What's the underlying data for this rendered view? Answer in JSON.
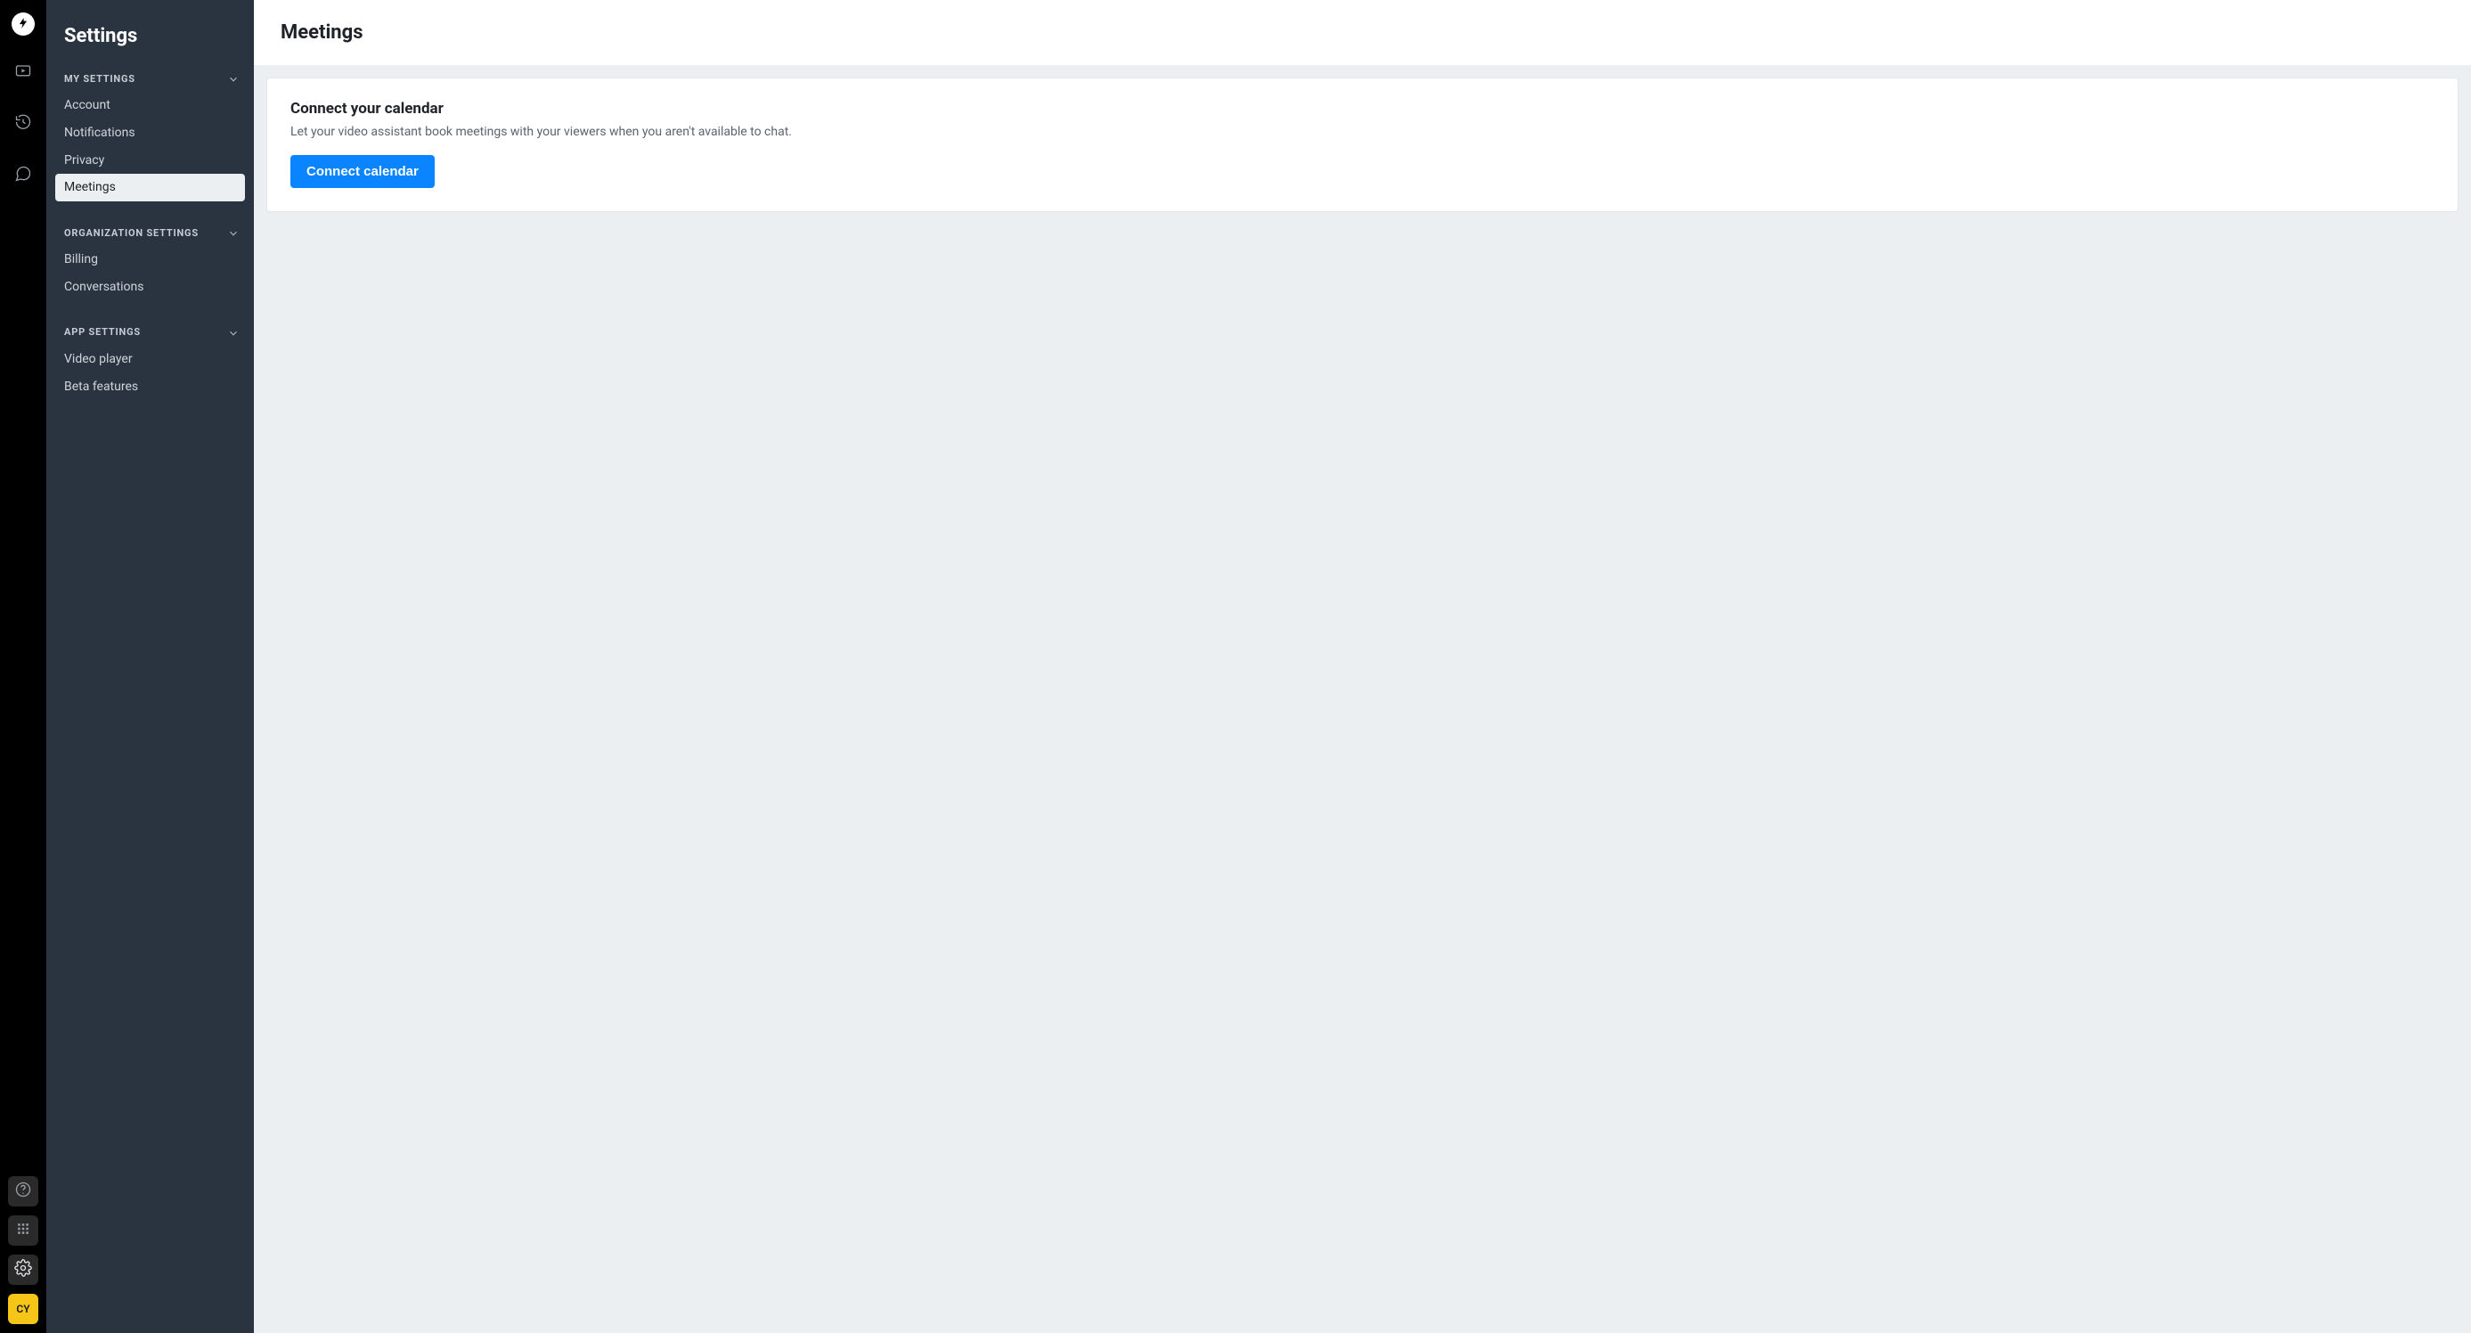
{
  "rail": {
    "avatar_initials": "CY"
  },
  "sidebar": {
    "title": "Settings",
    "sections": [
      {
        "label": "MY SETTINGS",
        "items": [
          {
            "label": "Account",
            "active": false
          },
          {
            "label": "Notifications",
            "active": false
          },
          {
            "label": "Privacy",
            "active": false
          },
          {
            "label": "Meetings",
            "active": true
          }
        ]
      },
      {
        "label": "ORGANIZATION SETTINGS",
        "items": [
          {
            "label": "Billing",
            "active": false
          },
          {
            "label": "Conversations",
            "active": false
          }
        ]
      },
      {
        "label": "APP SETTINGS",
        "items": [
          {
            "label": "Video player",
            "active": false
          },
          {
            "label": "Beta features",
            "active": false
          }
        ]
      }
    ]
  },
  "main": {
    "page_title": "Meetings",
    "card": {
      "title": "Connect your calendar",
      "description": "Let your video assistant book meetings with your viewers when you aren't available to chat.",
      "button_label": "Connect calendar"
    }
  }
}
